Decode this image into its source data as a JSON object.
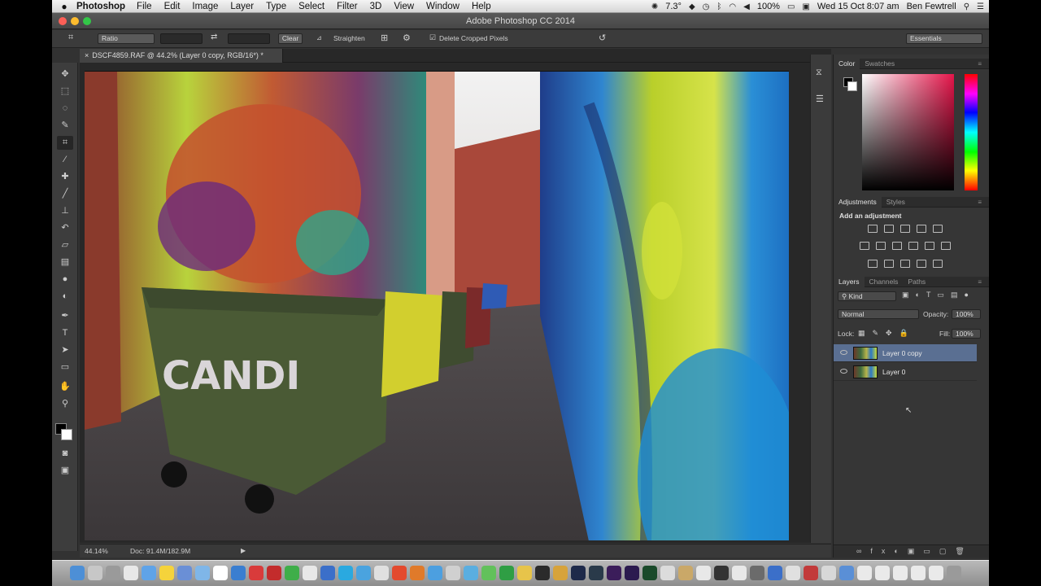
{
  "menubar": {
    "app_name": "Photoshop",
    "items": [
      "File",
      "Edit",
      "Image",
      "Layer",
      "Type",
      "Select",
      "Filter",
      "3D",
      "View",
      "Window",
      "Help"
    ],
    "temperature": "7.3°",
    "battery": "100%",
    "datetime": "Wed 15 Oct  8:07 am",
    "user": "Ben Fewtrell"
  },
  "window": {
    "title": "Adobe Photoshop CC 2014"
  },
  "options": {
    "ratio": "Ratio",
    "clear": "Clear",
    "straighten": "Straighten",
    "delete_cropped": "Delete Cropped Pixels",
    "workspace": "Essentials"
  },
  "document": {
    "tab_label": "DSCF4859.RAF @ 44.2% (Layer 0 copy, RGB/16*) *",
    "zoom": "44.14%",
    "doc_size": "Doc: 91.4M/182.9M"
  },
  "color_panel": {
    "tabs": [
      "Color",
      "Swatches"
    ],
    "foreground": "#000000",
    "background": "#ffffff",
    "hue": "#e5154a"
  },
  "adjustments_panel": {
    "tabs": [
      "Adjustments",
      "Styles"
    ],
    "heading": "Add an adjustment"
  },
  "layers_panel": {
    "tabs": [
      "Layers",
      "Channels",
      "Paths"
    ],
    "filter": "Kind",
    "blend_mode": "Normal",
    "opacity_label": "Opacity:",
    "opacity": "100%",
    "lock_label": "Lock:",
    "fill_label": "Fill:",
    "fill": "100%",
    "layers": [
      {
        "name": "Layer 0 copy",
        "selected": true
      },
      {
        "name": "Layer 0",
        "selected": false
      }
    ]
  },
  "tools": [
    "move-tool",
    "marquee-tool",
    "lasso-tool",
    "quick-select-tool",
    "crop-tool",
    "eyedropper-tool",
    "spot-heal-tool",
    "brush-tool",
    "clone-stamp-tool",
    "history-brush-tool",
    "eraser-tool",
    "gradient-tool",
    "blur-tool",
    "dodge-tool",
    "pen-tool",
    "type-tool",
    "path-select-tool",
    "rectangle-tool",
    "hand-tool",
    "zoom-tool"
  ]
}
